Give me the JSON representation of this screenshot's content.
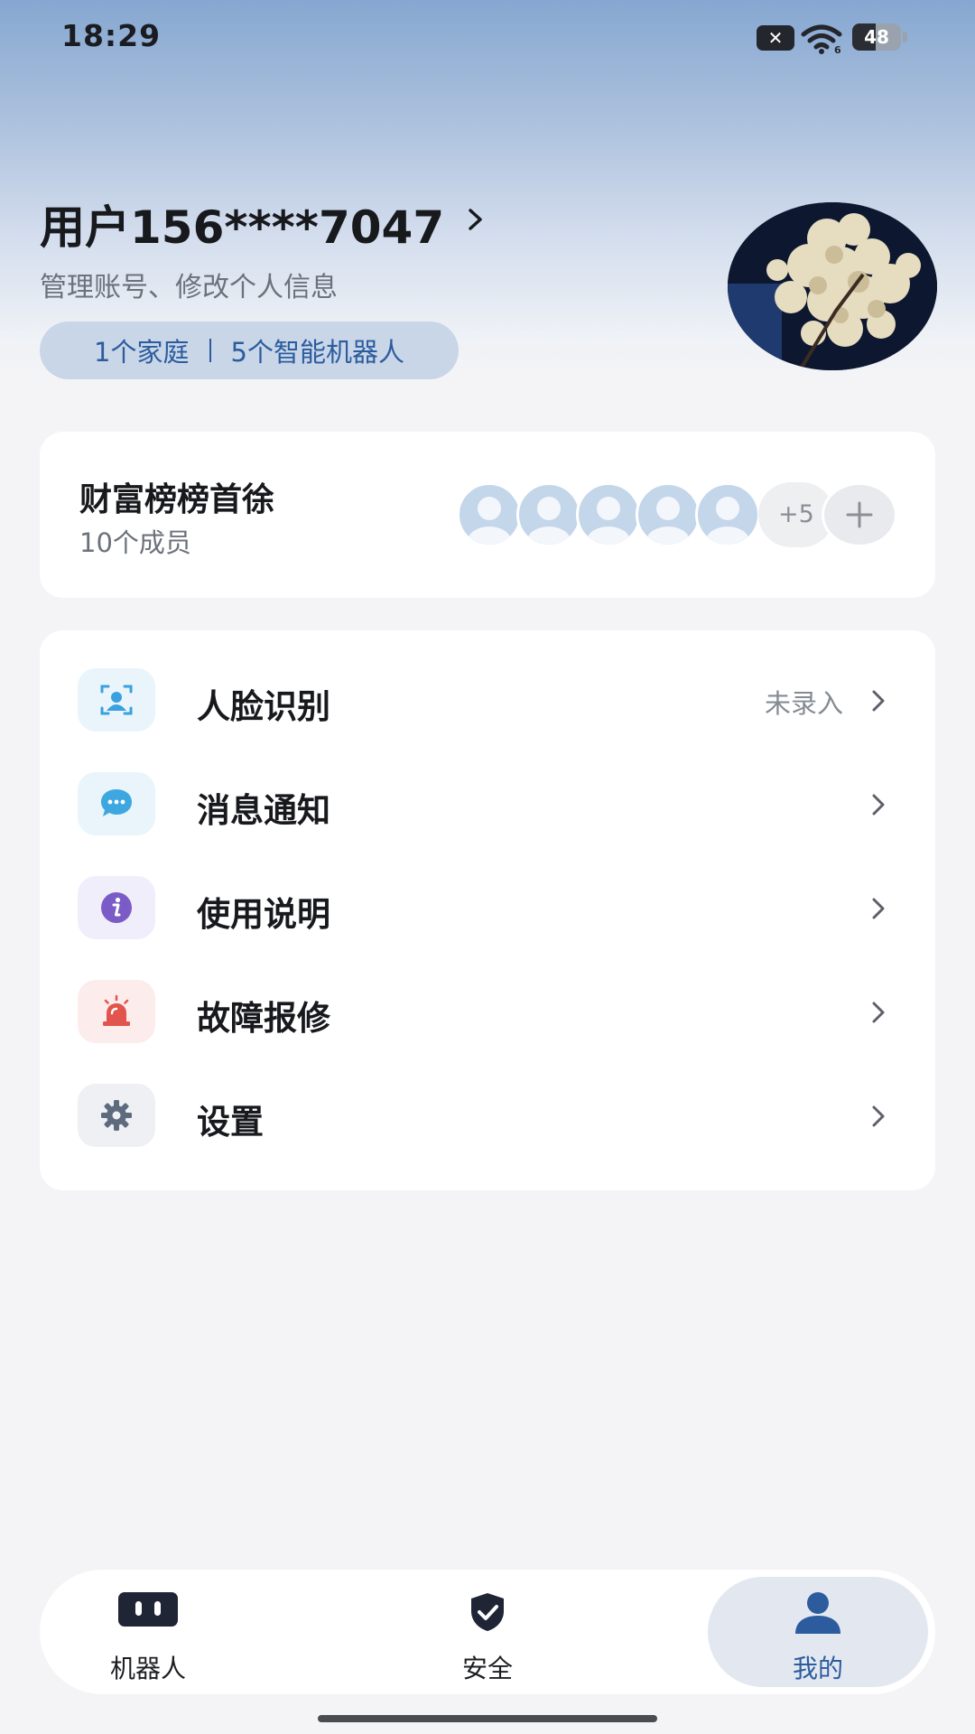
{
  "status_bar": {
    "time": "18:29",
    "battery": "48",
    "battery_level": 0.48
  },
  "profile": {
    "name": "用户156****7047",
    "subtitle": "管理账号、修改个人信息",
    "families": "1个家庭",
    "robots": "5个智能机器人"
  },
  "family": {
    "name": "财富榜榜首徐",
    "member_count": "10个成员",
    "more_members": "+5"
  },
  "menu": [
    {
      "label": "人脸识别",
      "value": "未录入",
      "icon": "face-id-icon",
      "icon_bg": "#e9f5fb",
      "icon_color": "#3aa0df"
    },
    {
      "label": "消息通知",
      "value": "",
      "icon": "message-icon",
      "icon_bg": "#e9f5fb",
      "icon_color": "#3ea7e0"
    },
    {
      "label": "使用说明",
      "value": "",
      "icon": "info-icon",
      "icon_bg": "#f1eefb",
      "icon_color": "#7b5cc7"
    },
    {
      "label": "故障报修",
      "value": "",
      "icon": "alarm-icon",
      "icon_bg": "#fdecec",
      "icon_color": "#e2544e"
    },
    {
      "label": "设置",
      "value": "",
      "icon": "gear-icon",
      "icon_bg": "#eef0f3",
      "icon_color": "#5e6a7d"
    }
  ],
  "nav": {
    "robot": "机器人",
    "security": "安全",
    "mine": "我的",
    "active": "mine",
    "active_color": "#2c5c9e"
  }
}
